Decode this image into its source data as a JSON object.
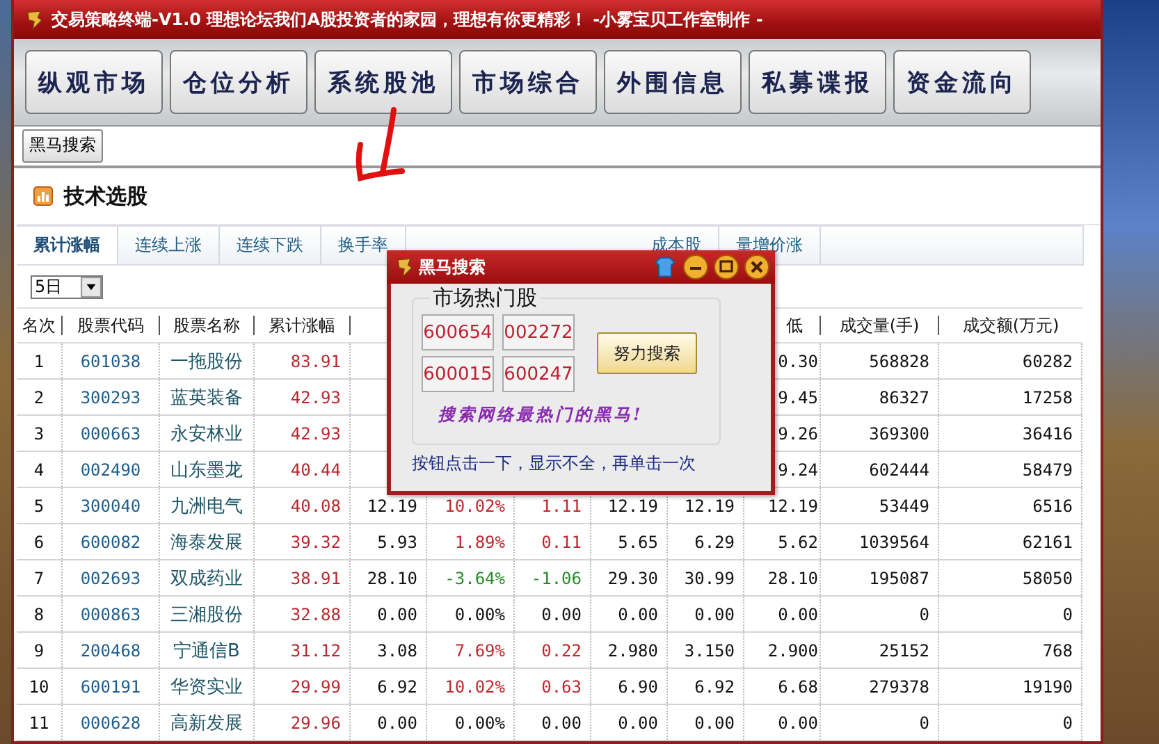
{
  "window": {
    "title": "交易策略终端-V1.0  理想论坛我们A股投资者的家园，理想有你更精彩！ -小雾宝贝工作室制作 -"
  },
  "toolbar": [
    "纵观市场",
    "仓位分析",
    "系统股池",
    "市场综合",
    "外围信息",
    "私募谍报",
    "资金流向"
  ],
  "sub_toolbar": {
    "button": "黑马搜索"
  },
  "panel": {
    "title": "技术选股",
    "tabs": [
      {
        "label": "累计涨幅",
        "selected": true
      },
      {
        "label": "连续上涨",
        "selected": false
      },
      {
        "label": "连续下跌",
        "selected": false
      },
      {
        "label": "换手率",
        "selected": false
      },
      {
        "label": "成本股",
        "selected": false
      },
      {
        "label": "量增价涨",
        "selected": false
      }
    ],
    "period": "5日",
    "table": {
      "columns": [
        "名次",
        "股票代码",
        "股票名称",
        "累计涨幅",
        null,
        null,
        null,
        null,
        null,
        "低",
        "成交量(手)",
        "成交额(万元)"
      ],
      "rows": [
        {
          "cells": [
            "1",
            "601038",
            "一拖股份",
            "83.91",
            null,
            null,
            null,
            null,
            null,
            "0.30",
            "568828",
            "60282"
          ]
        },
        {
          "cells": [
            "2",
            "300293",
            "蓝英装备",
            "42.93",
            null,
            null,
            null,
            null,
            null,
            "9.45",
            "86327",
            "17258"
          ]
        },
        {
          "cells": [
            "3",
            "000663",
            "永安林业",
            "42.93",
            null,
            null,
            null,
            null,
            null,
            "9.26",
            "369300",
            "36416"
          ]
        },
        {
          "cells": [
            "4",
            "002490",
            "山东墨龙",
            "40.44",
            null,
            null,
            null,
            null,
            null,
            "9.24",
            "602444",
            "58479"
          ]
        },
        {
          "cells": [
            "5",
            "300040",
            "九洲电气",
            "40.08",
            "12.19",
            "10.02%",
            "1.11",
            "12.19",
            "12.19",
            "12.19",
            "53449",
            "6516"
          ],
          "color": "#c0282e"
        },
        {
          "cells": [
            "6",
            "600082",
            "海泰发展",
            "39.32",
            "5.93",
            "1.89%",
            "0.11",
            "5.65",
            "6.29",
            "5.62",
            "1039564",
            "62161"
          ],
          "color": "#c0282e"
        },
        {
          "cells": [
            "7",
            "002693",
            "双成药业",
            "38.91",
            "28.10",
            "-3.64%",
            "-1.06",
            "29.30",
            "30.99",
            "28.10",
            "195087",
            "58050"
          ],
          "color": "#2a8a2a"
        },
        {
          "cells": [
            "8",
            "000863",
            "三湘股份",
            "32.88",
            "0.00",
            "0.00%",
            "0.00",
            "0.00",
            "0.00",
            "0.00",
            "0",
            "0"
          ],
          "color": "#111111"
        },
        {
          "cells": [
            "9",
            "200468",
            "宁通信B",
            "31.12",
            "3.08",
            "7.69%",
            "0.22",
            "2.980",
            "3.150",
            "2.900",
            "25152",
            "768"
          ],
          "color": "#c0282e"
        },
        {
          "cells": [
            "10",
            "600191",
            "华资实业",
            "29.99",
            "6.92",
            "10.02%",
            "0.63",
            "6.90",
            "6.92",
            "6.68",
            "279378",
            "19190"
          ],
          "color": "#c0282e"
        },
        {
          "cells": [
            "11",
            "000628",
            "高新发展",
            "29.96",
            "0.00",
            "0.00%",
            "0.00",
            "0.00",
            "0.00",
            "0.00",
            "0",
            "0"
          ],
          "color": "#111111"
        }
      ]
    }
  },
  "popup": {
    "title": "黑马搜索",
    "group_title": "市场热门股",
    "codes": [
      "600654",
      "002272",
      "600015",
      "600247"
    ],
    "button": "努力搜索",
    "slogan": "搜索网络最热门的黑马!",
    "hint": "按钮点击一下，显示不全，再单击一次"
  }
}
